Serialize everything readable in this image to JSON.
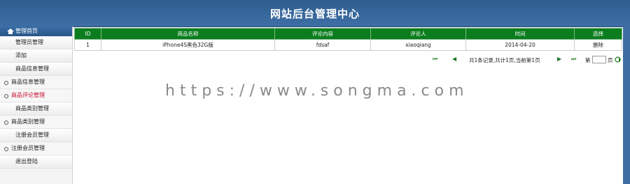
{
  "header": {
    "title": "网站后台管理中心"
  },
  "sidebar": {
    "home_label": "管理首页",
    "rows": [
      {
        "label": "管理员管理",
        "type": "sub"
      },
      {
        "label": "添加",
        "type": "sub"
      },
      {
        "label": "商品信息管理",
        "type": "sub"
      }
    ],
    "groups": [
      {
        "label": "商品信息管理",
        "active": false
      },
      {
        "label": "商品评论管理",
        "active": true
      }
    ],
    "sub2": {
      "label": "商品类别管理"
    },
    "group3": {
      "label": "商品类别管理"
    },
    "sub3": {
      "label": "注册会员管理"
    },
    "group4": {
      "label": "注册会员管理"
    },
    "sub4": {
      "label": "退出登陆"
    }
  },
  "table": {
    "headers": [
      "ID",
      "商品名称",
      "评论内容",
      "评论人",
      "时间",
      "选择"
    ],
    "rows": [
      [
        "1",
        "iPhone4S黑色32G版",
        "fdsaf",
        "xiaoqiang",
        "2014-04-20",
        "删除"
      ]
    ]
  },
  "pager": {
    "first": "⏮",
    "prev": "◀",
    "summary": "共1条记录,共计1页,当前第1页",
    "next": "▶",
    "last": "⏭",
    "goto_prefix": "第",
    "goto_suffix": "页",
    "go_icon": "go-icon"
  },
  "watermark": "https://www.songma.com",
  "colors": {
    "header": "#3d6fa5",
    "table_header": "#0b7d1e",
    "active_menu": "#c8102e"
  }
}
